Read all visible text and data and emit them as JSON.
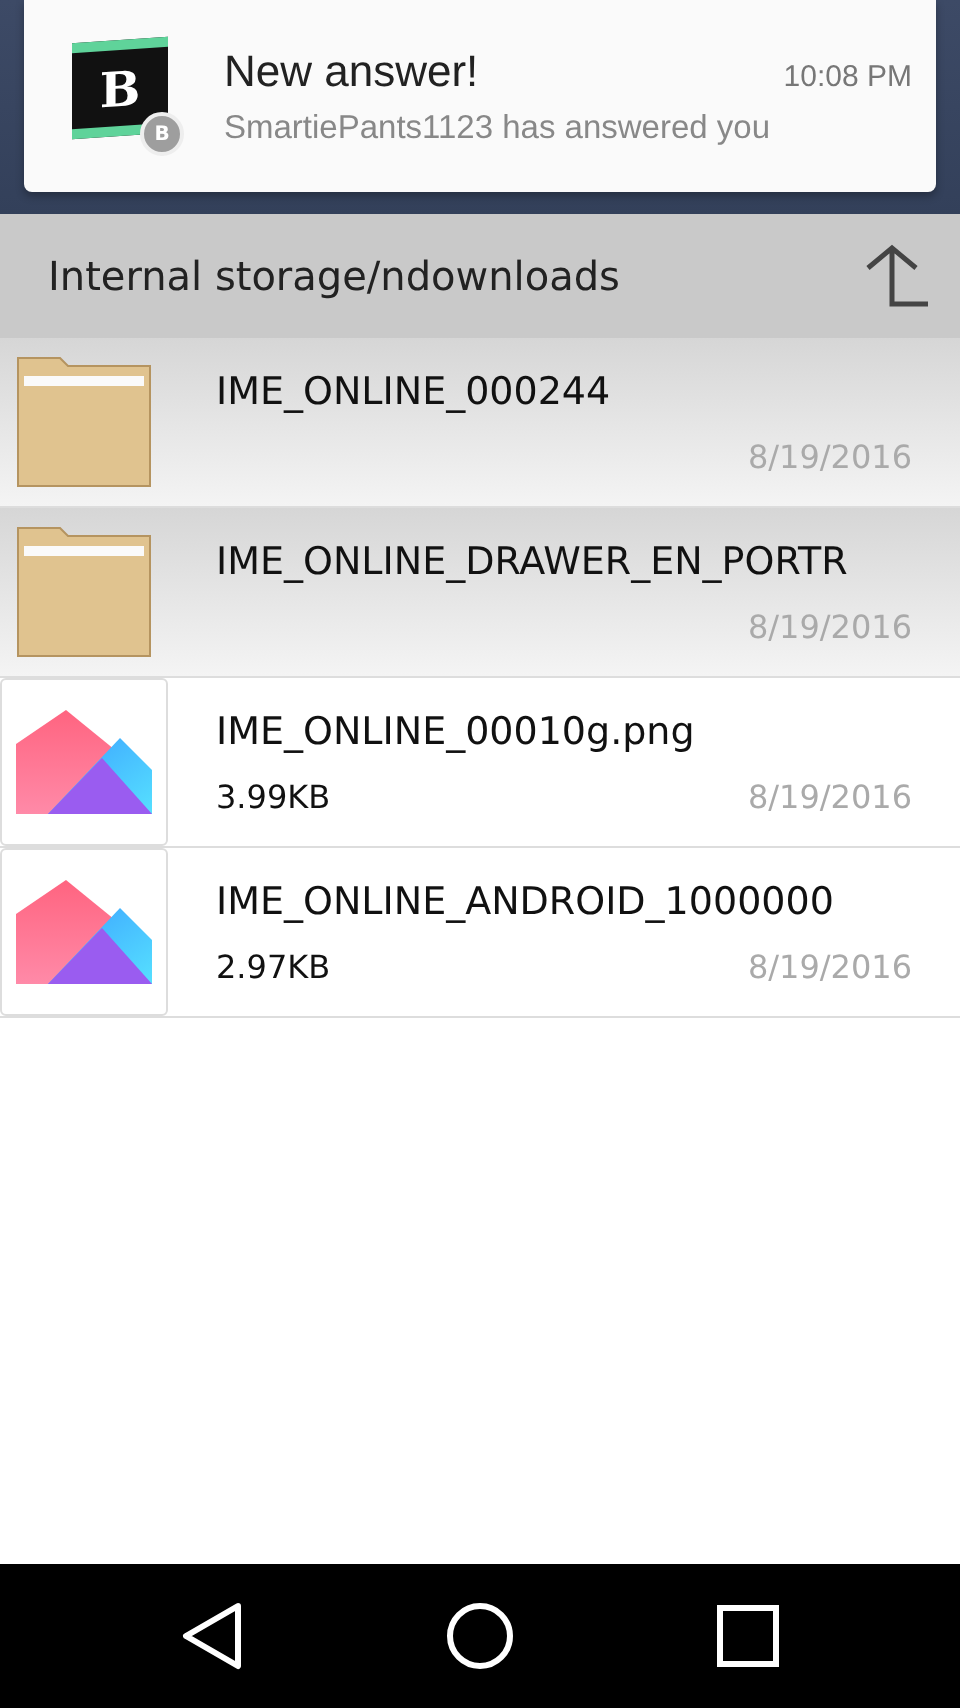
{
  "notification": {
    "title": "New answer!",
    "time": "10:08 PM",
    "text": "SmartiePants1123 has answered you",
    "app_letter": "B",
    "badge_letter": "B"
  },
  "header": {
    "path": "Internal storage/ndownloads"
  },
  "files": [
    {
      "kind": "folder",
      "name": "IME_ONLINE_000244",
      "date": "8/19/2016"
    },
    {
      "kind": "folder",
      "name": "IME_ONLINE_DRAWER_EN_PORTR",
      "date": "8/19/2016"
    },
    {
      "kind": "image",
      "name": "IME_ONLINE_00010g.png",
      "size": "3.99KB",
      "date": "8/19/2016"
    },
    {
      "kind": "image",
      "name": "IME_ONLINE_ANDROID_1000000",
      "size": "2.97KB",
      "date": "8/19/2016"
    }
  ]
}
